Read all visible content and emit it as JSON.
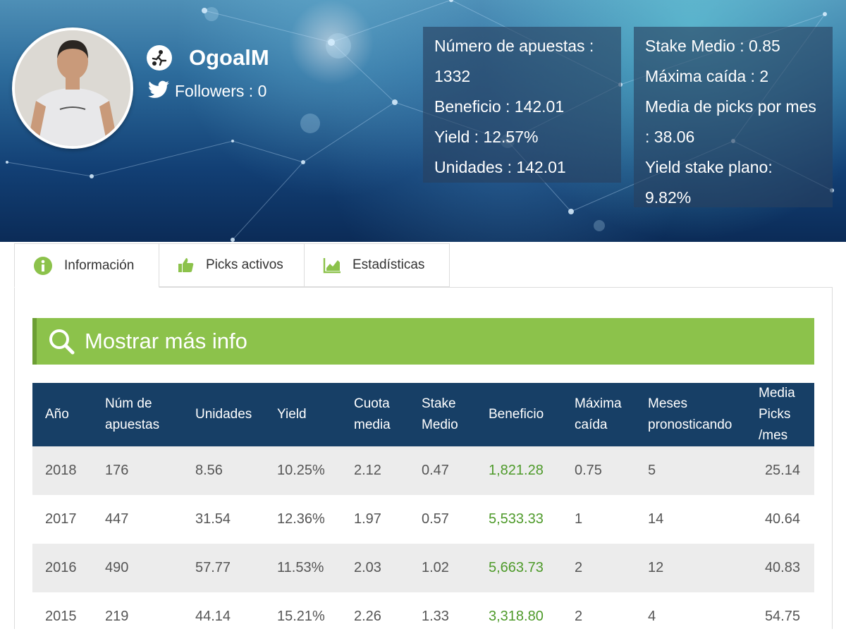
{
  "profile": {
    "username": "OgoalM",
    "followers_label": "Followers : 0"
  },
  "stats_left": [
    "Número de apuestas : 1332",
    "Beneficio : 142.01",
    "Yield : 12.57%",
    "Unidades : 142.01"
  ],
  "stats_right": [
    "Stake Medio : 0.85",
    "Máxima caída : 2",
    "Media de picks por mes : 38.06",
    "Yield stake plano: 9.82%"
  ],
  "tabs": [
    {
      "label": "Información",
      "icon": "info-icon",
      "active": true
    },
    {
      "label": "Picks activos",
      "icon": "thumbs-up-icon",
      "active": false
    },
    {
      "label": "Estadísticas",
      "icon": "chart-icon",
      "active": false
    }
  ],
  "info_bar": {
    "title": "Mostrar más info",
    "icon": "search-icon"
  },
  "table": {
    "headers": [
      "Año",
      "Núm de apuestas",
      "Unidades",
      "Yield",
      "Cuota media",
      "Stake Medio",
      "Beneficio",
      "Máxima caída",
      "Meses pronosticando",
      "Media Picks /mes"
    ],
    "rows": [
      [
        "2018",
        "176",
        "8.56",
        "10.25%",
        "2.12",
        "0.47",
        "1,821.28",
        "0.75",
        "5",
        "25.14"
      ],
      [
        "2017",
        "447",
        "31.54",
        "12.36%",
        "1.97",
        "0.57",
        "5,533.33",
        "1",
        "14",
        "40.64"
      ],
      [
        "2016",
        "490",
        "57.77",
        "11.53%",
        "2.03",
        "1.02",
        "5,663.73",
        "2",
        "12",
        "40.83"
      ],
      [
        "2015",
        "219",
        "44.14",
        "15.21%",
        "2.26",
        "1.33",
        "3,318.80",
        "2",
        "4",
        "54.75"
      ]
    ]
  },
  "colors": {
    "header_bg": "#173f66",
    "green_bar": "#8cc24b",
    "positive": "#4e9a2a",
    "twitter": "#1da1f2"
  }
}
